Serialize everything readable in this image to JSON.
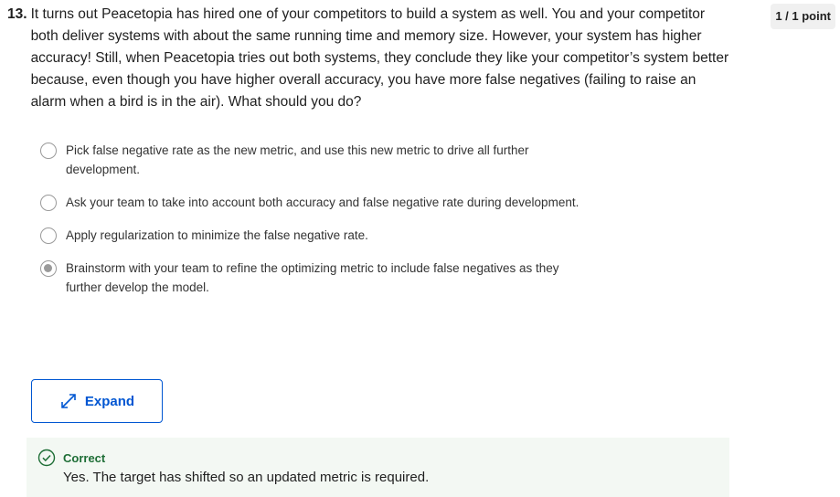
{
  "question": {
    "number": "13.",
    "text": "It turns out Peacetopia has hired one of your competitors to build a system as well. You and your competitor both deliver systems with about the same running time and memory size. However, your system has higher accuracy! Still, when Peacetopia tries out both systems, they conclude they like your competitor’s system better because, even though you have higher overall accuracy, you have more false negatives (failing to raise an alarm when a bird is in the air). What should you do?",
    "points": "1 / 1 point"
  },
  "options": [
    {
      "label": "Pick false negative rate as the new metric, and use this new metric to drive all further development.",
      "selected": false
    },
    {
      "label": "Ask your team to take into account both accuracy and false negative rate during development.",
      "selected": false
    },
    {
      "label": "Apply regularization to minimize the false negative rate.",
      "selected": false
    },
    {
      "label": "Brainstorm with your team to refine the optimizing metric to include false negatives as they further develop the model.",
      "selected": true
    }
  ],
  "expand_button": {
    "label": "Expand",
    "icon": "expand-arrows-icon"
  },
  "feedback": {
    "title": "Correct",
    "text": "Yes. The target has shifted so an updated metric is required.",
    "icon": "check-circle-icon",
    "color": "#1e6e36"
  },
  "colors": {
    "accent": "#0056d2",
    "success": "#1e6e36",
    "feedback_bg": "#f3f8f3"
  }
}
